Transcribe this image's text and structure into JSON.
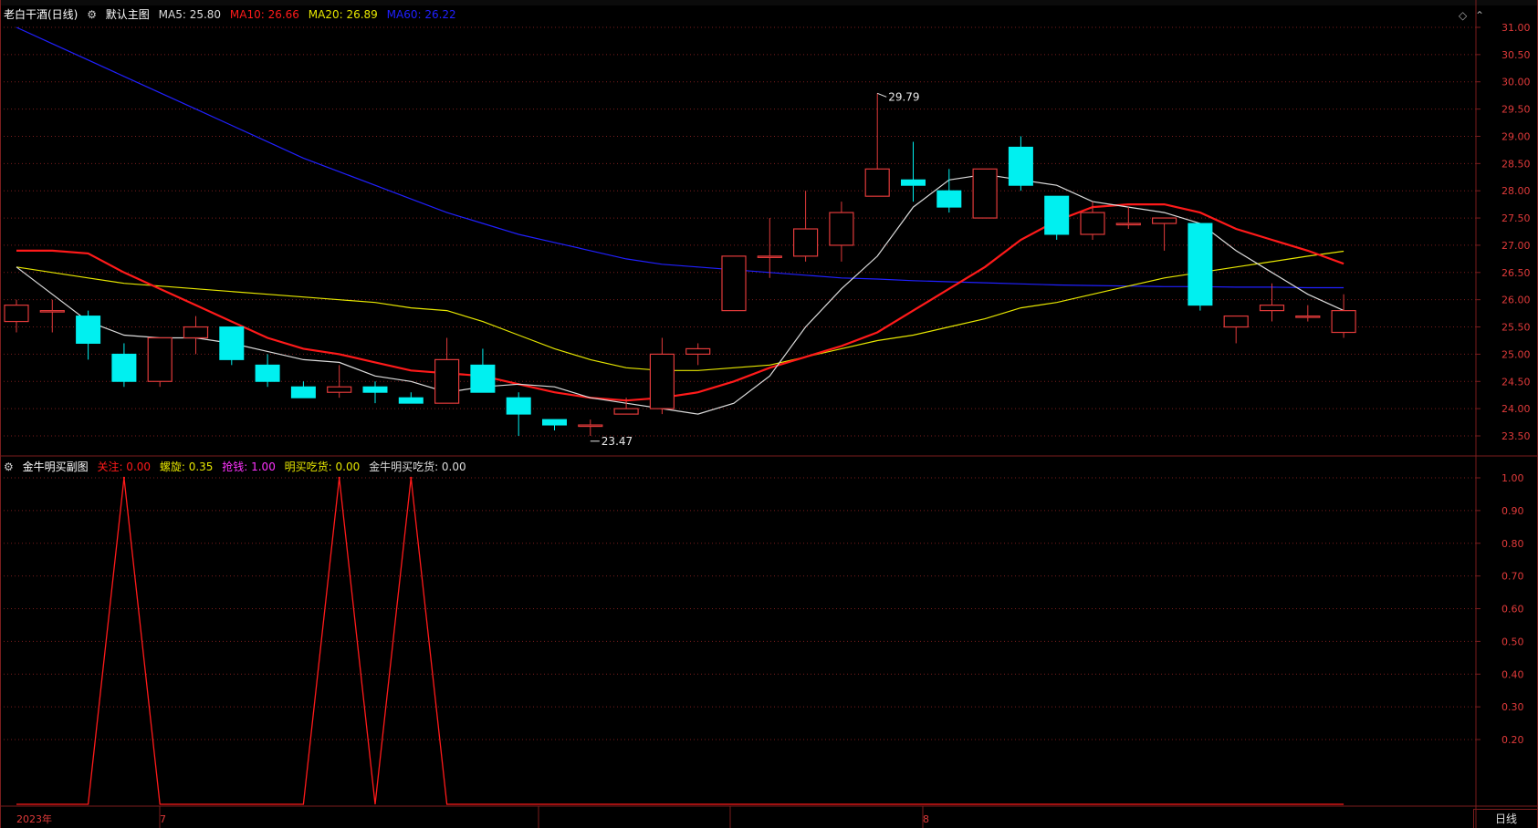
{
  "main_legend": {
    "title": "老白干酒(日线)",
    "template": "默认主图",
    "ma5": "MA5: 25.80",
    "ma10": "MA10: 26.66",
    "ma20": "MA20: 26.89",
    "ma60": "MA60: 26.22"
  },
  "sub_legend": {
    "title": "金牛明买副图",
    "guanzhu": "关注: 0.00",
    "luoxuan": "螺旋: 0.35",
    "qiangqian": "抢钱: 1.00",
    "mingmai": "明买吃货: 0.00",
    "jinniu": "金牛明买吃货: 0.00"
  },
  "bottom": {
    "year_label": "2023年",
    "jul_label": "7",
    "aug_label": "8",
    "period_label": "日线"
  },
  "colors": {
    "up": "#e03a3a",
    "down": "#00f0f0",
    "ma5": "#dcdcdc",
    "ma10": "#ff1a1a",
    "ma20": "#e6e600",
    "ma60": "#2020ff",
    "grid": "#7a1d1d"
  },
  "chart_data": [
    {
      "type": "candlestick",
      "price_axis": {
        "min": 23.0,
        "max": 31.2,
        "ticks": [
          "31.00",
          "30.50",
          "30.00",
          "29.50",
          "29.00",
          "28.50",
          "28.00",
          "27.50",
          "27.00",
          "26.50",
          "26.00",
          "25.50",
          "25.00",
          "24.50",
          "24.00",
          "23.50"
        ]
      },
      "annotations": {
        "high": "29.79",
        "low": "23.47"
      },
      "candles": [
        {
          "o": 25.6,
          "h": 26.0,
          "l": 25.4,
          "c": 25.9
        },
        {
          "o": 25.8,
          "h": 26.0,
          "l": 25.4,
          "c": 25.8
        },
        {
          "o": 25.7,
          "h": 25.8,
          "l": 24.9,
          "c": 25.2
        },
        {
          "o": 25.0,
          "h": 25.2,
          "l": 24.4,
          "c": 24.5
        },
        {
          "o": 24.5,
          "h": 25.3,
          "l": 24.4,
          "c": 25.3
        },
        {
          "o": 25.3,
          "h": 25.7,
          "l": 25.0,
          "c": 25.5
        },
        {
          "o": 25.5,
          "h": 25.5,
          "l": 24.8,
          "c": 24.9
        },
        {
          "o": 24.8,
          "h": 25.0,
          "l": 24.4,
          "c": 24.5
        },
        {
          "o": 24.4,
          "h": 24.5,
          "l": 24.2,
          "c": 24.2
        },
        {
          "o": 24.3,
          "h": 24.8,
          "l": 24.2,
          "c": 24.4
        },
        {
          "o": 24.4,
          "h": 24.5,
          "l": 24.1,
          "c": 24.3
        },
        {
          "o": 24.2,
          "h": 24.3,
          "l": 24.1,
          "c": 24.1
        },
        {
          "o": 24.1,
          "h": 25.3,
          "l": 24.1,
          "c": 24.9
        },
        {
          "o": 24.8,
          "h": 25.1,
          "l": 24.3,
          "c": 24.3
        },
        {
          "o": 24.2,
          "h": 24.3,
          "l": 23.5,
          "c": 23.9
        },
        {
          "o": 23.8,
          "h": 23.8,
          "l": 23.6,
          "c": 23.7
        },
        {
          "o": 23.7,
          "h": 23.8,
          "l": 23.5,
          "c": 23.7
        },
        {
          "o": 23.9,
          "h": 24.2,
          "l": 23.9,
          "c": 24.0
        },
        {
          "o": 24.0,
          "h": 25.3,
          "l": 23.9,
          "c": 25.0
        },
        {
          "o": 25.0,
          "h": 25.2,
          "l": 24.8,
          "c": 25.1
        },
        {
          "o": 25.8,
          "h": 26.8,
          "l": 25.8,
          "c": 26.8
        },
        {
          "o": 26.8,
          "h": 27.5,
          "l": 26.4,
          "c": 26.8
        },
        {
          "o": 26.8,
          "h": 28.0,
          "l": 26.7,
          "c": 27.3
        },
        {
          "o": 27.0,
          "h": 27.8,
          "l": 26.7,
          "c": 27.6
        },
        {
          "o": 27.9,
          "h": 29.79,
          "l": 27.9,
          "c": 28.4
        },
        {
          "o": 28.2,
          "h": 28.9,
          "l": 27.8,
          "c": 28.1
        },
        {
          "o": 28.0,
          "h": 28.4,
          "l": 27.6,
          "c": 27.7
        },
        {
          "o": 27.5,
          "h": 28.4,
          "l": 27.5,
          "c": 28.4
        },
        {
          "o": 28.8,
          "h": 29.0,
          "l": 28.0,
          "c": 28.1
        },
        {
          "o": 27.9,
          "h": 27.9,
          "l": 27.1,
          "c": 27.2
        },
        {
          "o": 27.2,
          "h": 27.8,
          "l": 27.1,
          "c": 27.6
        },
        {
          "o": 27.4,
          "h": 27.7,
          "l": 27.3,
          "c": 27.4
        },
        {
          "o": 27.4,
          "h": 27.5,
          "l": 26.9,
          "c": 27.5
        },
        {
          "o": 27.4,
          "h": 27.4,
          "l": 25.8,
          "c": 25.9
        },
        {
          "o": 25.5,
          "h": 25.7,
          "l": 25.2,
          "c": 25.7
        },
        {
          "o": 25.8,
          "h": 26.3,
          "l": 25.6,
          "c": 25.9
        },
        {
          "o": 25.7,
          "h": 25.9,
          "l": 25.6,
          "c": 25.7
        },
        {
          "o": 25.4,
          "h": 26.1,
          "l": 25.3,
          "c": 25.8
        }
      ],
      "ma5": [
        26.6,
        26.1,
        25.6,
        25.35,
        25.3,
        25.3,
        25.2,
        25.05,
        24.9,
        24.85,
        24.6,
        24.5,
        24.3,
        24.4,
        24.45,
        24.4,
        24.2,
        24.1,
        24.0,
        23.9,
        24.1,
        24.6,
        25.5,
        26.2,
        26.8,
        27.7,
        28.2,
        28.3,
        28.2,
        28.1,
        27.8,
        27.7,
        27.6,
        27.4,
        26.9,
        26.5,
        26.1,
        25.8
      ],
      "ma10": [
        26.9,
        26.9,
        26.85,
        26.5,
        26.2,
        25.9,
        25.6,
        25.3,
        25.1,
        25.0,
        24.85,
        24.7,
        24.65,
        24.6,
        24.45,
        24.3,
        24.2,
        24.15,
        24.2,
        24.3,
        24.5,
        24.75,
        24.95,
        25.15,
        25.4,
        25.8,
        26.2,
        26.6,
        27.1,
        27.45,
        27.7,
        27.75,
        27.75,
        27.6,
        27.3,
        27.1,
        26.9,
        26.66
      ],
      "ma20": [
        26.6,
        26.5,
        26.4,
        26.3,
        26.25,
        26.2,
        26.15,
        26.1,
        26.05,
        26.0,
        25.95,
        25.85,
        25.8,
        25.6,
        25.35,
        25.1,
        24.9,
        24.75,
        24.7,
        24.7,
        24.75,
        24.8,
        24.95,
        25.1,
        25.25,
        25.35,
        25.5,
        25.65,
        25.85,
        25.95,
        26.1,
        26.25,
        26.4,
        26.5,
        26.6,
        26.7,
        26.8,
        26.89
      ],
      "ma60": [
        31.0,
        30.7,
        30.4,
        30.1,
        29.8,
        29.5,
        29.2,
        28.9,
        28.6,
        28.35,
        28.1,
        27.85,
        27.6,
        27.4,
        27.2,
        27.05,
        26.9,
        26.75,
        26.65,
        26.6,
        26.55,
        26.5,
        26.45,
        26.4,
        26.38,
        26.35,
        26.33,
        26.31,
        26.29,
        26.27,
        26.26,
        26.25,
        26.24,
        26.24,
        26.23,
        26.23,
        26.22,
        26.22
      ]
    },
    {
      "type": "line",
      "name": "关注",
      "y_axis": {
        "min": 0.1,
        "max": 1.0,
        "ticks": [
          "1.00",
          "0.90",
          "0.80",
          "0.70",
          "0.60",
          "0.50",
          "0.40",
          "0.30",
          "0.20"
        ]
      },
      "x": [
        0,
        2,
        3,
        4,
        5,
        6,
        7,
        8,
        9,
        10,
        11,
        12,
        13,
        14,
        15,
        16,
        17,
        18,
        19,
        20,
        21,
        22,
        23,
        24,
        25,
        26,
        27,
        28,
        29,
        30,
        31,
        32,
        33,
        34,
        35,
        36,
        37
      ],
      "values": [
        0,
        0,
        1,
        0,
        0,
        0,
        0,
        0,
        1,
        0,
        1,
        0,
        0,
        0,
        0,
        0,
        0,
        0,
        0,
        0,
        0,
        0,
        0,
        0,
        0,
        0,
        0,
        0,
        0,
        0,
        0,
        0,
        0,
        0,
        0,
        0,
        0
      ]
    }
  ]
}
